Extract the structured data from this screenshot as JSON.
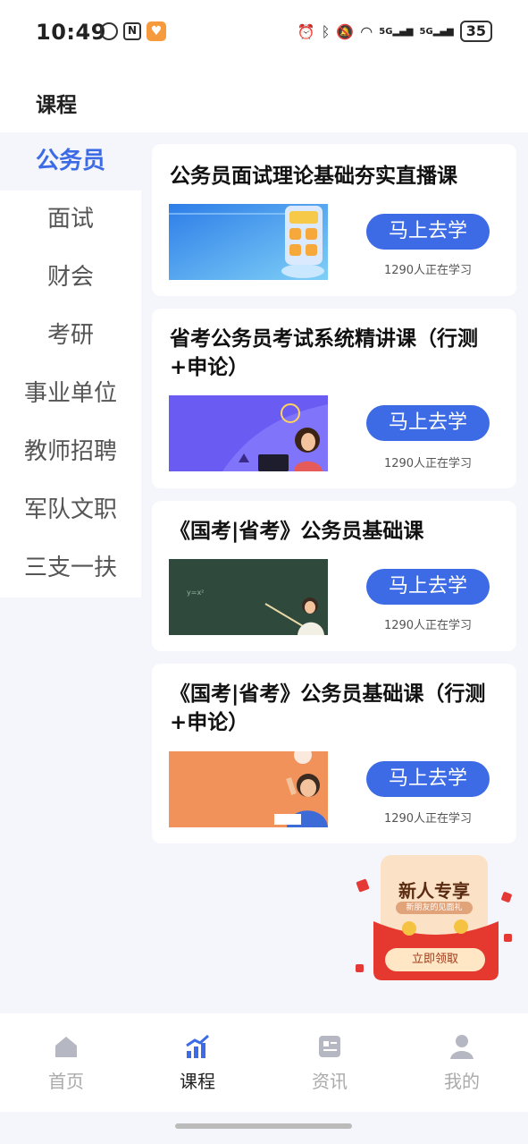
{
  "status_bar": {
    "time": "10:49",
    "battery": "35",
    "network_1": "5G",
    "network_2": "5G"
  },
  "header": {
    "title": "课程"
  },
  "sidebar": {
    "items": [
      {
        "label": "公务员",
        "active": true
      },
      {
        "label": "面试"
      },
      {
        "label": "财会"
      },
      {
        "label": "考研"
      },
      {
        "label": "事业单位"
      },
      {
        "label": "教师招聘"
      },
      {
        "label": "军队文职"
      },
      {
        "label": "三支一扶"
      }
    ]
  },
  "courses": [
    {
      "title": "公务员面试理论基础夯实直播课",
      "button": "马上去学",
      "learners": "1290人正在学习",
      "thumb_icon": "calculator-illustration-icon"
    },
    {
      "title": "省考公务员考试系统精讲课（行测+申论）",
      "button": "马上去学",
      "learners": "1290人正在学习",
      "thumb_icon": "woman-laptop-illustration-icon"
    },
    {
      "title": "《国考|省考》公务员基础课",
      "button": "马上去学",
      "learners": "1290人正在学习",
      "thumb_icon": "teacher-chalkboard-illustration-icon"
    },
    {
      "title": "《国考|省考》公务员基础课（行测+申论）",
      "button": "马上去学",
      "learners": "1290人正在学习",
      "thumb_icon": "student-studying-illustration-icon"
    }
  ],
  "promo": {
    "title": "新人专享",
    "subtitle": "新朋友的见面礼",
    "button": "立即领取"
  },
  "bottom_nav": [
    {
      "label": "首页",
      "icon": "home-icon"
    },
    {
      "label": "课程",
      "icon": "chart-icon",
      "active": true
    },
    {
      "label": "资讯",
      "icon": "news-icon"
    },
    {
      "label": "我的",
      "icon": "user-icon"
    }
  ],
  "colors": {
    "accent": "#3d6be6",
    "background": "#f4f6fb"
  }
}
